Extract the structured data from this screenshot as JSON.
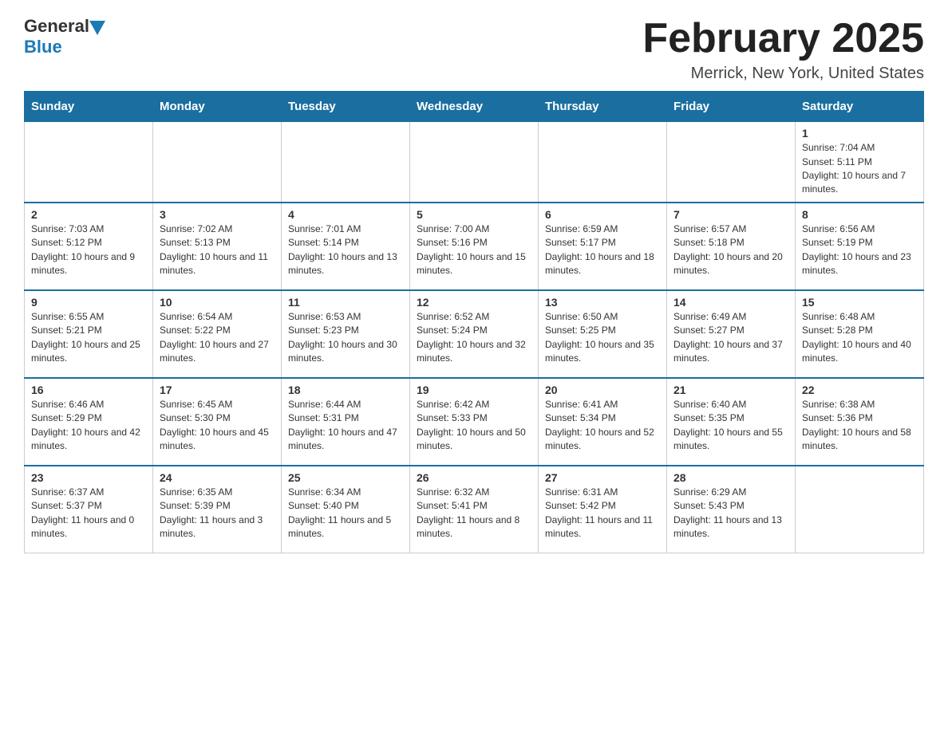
{
  "header": {
    "logo_general": "General",
    "logo_blue": "Blue",
    "month_title": "February 2025",
    "location": "Merrick, New York, United States"
  },
  "weekdays": [
    "Sunday",
    "Monday",
    "Tuesday",
    "Wednesday",
    "Thursday",
    "Friday",
    "Saturday"
  ],
  "weeks": [
    {
      "days": [
        {
          "date": "",
          "sunrise": "",
          "sunset": "",
          "daylight": ""
        },
        {
          "date": "",
          "sunrise": "",
          "sunset": "",
          "daylight": ""
        },
        {
          "date": "",
          "sunrise": "",
          "sunset": "",
          "daylight": ""
        },
        {
          "date": "",
          "sunrise": "",
          "sunset": "",
          "daylight": ""
        },
        {
          "date": "",
          "sunrise": "",
          "sunset": "",
          "daylight": ""
        },
        {
          "date": "",
          "sunrise": "",
          "sunset": "",
          "daylight": ""
        },
        {
          "date": "1",
          "sunrise": "Sunrise: 7:04 AM",
          "sunset": "Sunset: 5:11 PM",
          "daylight": "Daylight: 10 hours and 7 minutes."
        }
      ]
    },
    {
      "days": [
        {
          "date": "2",
          "sunrise": "Sunrise: 7:03 AM",
          "sunset": "Sunset: 5:12 PM",
          "daylight": "Daylight: 10 hours and 9 minutes."
        },
        {
          "date": "3",
          "sunrise": "Sunrise: 7:02 AM",
          "sunset": "Sunset: 5:13 PM",
          "daylight": "Daylight: 10 hours and 11 minutes."
        },
        {
          "date": "4",
          "sunrise": "Sunrise: 7:01 AM",
          "sunset": "Sunset: 5:14 PM",
          "daylight": "Daylight: 10 hours and 13 minutes."
        },
        {
          "date": "5",
          "sunrise": "Sunrise: 7:00 AM",
          "sunset": "Sunset: 5:16 PM",
          "daylight": "Daylight: 10 hours and 15 minutes."
        },
        {
          "date": "6",
          "sunrise": "Sunrise: 6:59 AM",
          "sunset": "Sunset: 5:17 PM",
          "daylight": "Daylight: 10 hours and 18 minutes."
        },
        {
          "date": "7",
          "sunrise": "Sunrise: 6:57 AM",
          "sunset": "Sunset: 5:18 PM",
          "daylight": "Daylight: 10 hours and 20 minutes."
        },
        {
          "date": "8",
          "sunrise": "Sunrise: 6:56 AM",
          "sunset": "Sunset: 5:19 PM",
          "daylight": "Daylight: 10 hours and 23 minutes."
        }
      ]
    },
    {
      "days": [
        {
          "date": "9",
          "sunrise": "Sunrise: 6:55 AM",
          "sunset": "Sunset: 5:21 PM",
          "daylight": "Daylight: 10 hours and 25 minutes."
        },
        {
          "date": "10",
          "sunrise": "Sunrise: 6:54 AM",
          "sunset": "Sunset: 5:22 PM",
          "daylight": "Daylight: 10 hours and 27 minutes."
        },
        {
          "date": "11",
          "sunrise": "Sunrise: 6:53 AM",
          "sunset": "Sunset: 5:23 PM",
          "daylight": "Daylight: 10 hours and 30 minutes."
        },
        {
          "date": "12",
          "sunrise": "Sunrise: 6:52 AM",
          "sunset": "Sunset: 5:24 PM",
          "daylight": "Daylight: 10 hours and 32 minutes."
        },
        {
          "date": "13",
          "sunrise": "Sunrise: 6:50 AM",
          "sunset": "Sunset: 5:25 PM",
          "daylight": "Daylight: 10 hours and 35 minutes."
        },
        {
          "date": "14",
          "sunrise": "Sunrise: 6:49 AM",
          "sunset": "Sunset: 5:27 PM",
          "daylight": "Daylight: 10 hours and 37 minutes."
        },
        {
          "date": "15",
          "sunrise": "Sunrise: 6:48 AM",
          "sunset": "Sunset: 5:28 PM",
          "daylight": "Daylight: 10 hours and 40 minutes."
        }
      ]
    },
    {
      "days": [
        {
          "date": "16",
          "sunrise": "Sunrise: 6:46 AM",
          "sunset": "Sunset: 5:29 PM",
          "daylight": "Daylight: 10 hours and 42 minutes."
        },
        {
          "date": "17",
          "sunrise": "Sunrise: 6:45 AM",
          "sunset": "Sunset: 5:30 PM",
          "daylight": "Daylight: 10 hours and 45 minutes."
        },
        {
          "date": "18",
          "sunrise": "Sunrise: 6:44 AM",
          "sunset": "Sunset: 5:31 PM",
          "daylight": "Daylight: 10 hours and 47 minutes."
        },
        {
          "date": "19",
          "sunrise": "Sunrise: 6:42 AM",
          "sunset": "Sunset: 5:33 PM",
          "daylight": "Daylight: 10 hours and 50 minutes."
        },
        {
          "date": "20",
          "sunrise": "Sunrise: 6:41 AM",
          "sunset": "Sunset: 5:34 PM",
          "daylight": "Daylight: 10 hours and 52 minutes."
        },
        {
          "date": "21",
          "sunrise": "Sunrise: 6:40 AM",
          "sunset": "Sunset: 5:35 PM",
          "daylight": "Daylight: 10 hours and 55 minutes."
        },
        {
          "date": "22",
          "sunrise": "Sunrise: 6:38 AM",
          "sunset": "Sunset: 5:36 PM",
          "daylight": "Daylight: 10 hours and 58 minutes."
        }
      ]
    },
    {
      "days": [
        {
          "date": "23",
          "sunrise": "Sunrise: 6:37 AM",
          "sunset": "Sunset: 5:37 PM",
          "daylight": "Daylight: 11 hours and 0 minutes."
        },
        {
          "date": "24",
          "sunrise": "Sunrise: 6:35 AM",
          "sunset": "Sunset: 5:39 PM",
          "daylight": "Daylight: 11 hours and 3 minutes."
        },
        {
          "date": "25",
          "sunrise": "Sunrise: 6:34 AM",
          "sunset": "Sunset: 5:40 PM",
          "daylight": "Daylight: 11 hours and 5 minutes."
        },
        {
          "date": "26",
          "sunrise": "Sunrise: 6:32 AM",
          "sunset": "Sunset: 5:41 PM",
          "daylight": "Daylight: 11 hours and 8 minutes."
        },
        {
          "date": "27",
          "sunrise": "Sunrise: 6:31 AM",
          "sunset": "Sunset: 5:42 PM",
          "daylight": "Daylight: 11 hours and 11 minutes."
        },
        {
          "date": "28",
          "sunrise": "Sunrise: 6:29 AM",
          "sunset": "Sunset: 5:43 PM",
          "daylight": "Daylight: 11 hours and 13 minutes."
        },
        {
          "date": "",
          "sunrise": "",
          "sunset": "",
          "daylight": ""
        }
      ]
    }
  ]
}
